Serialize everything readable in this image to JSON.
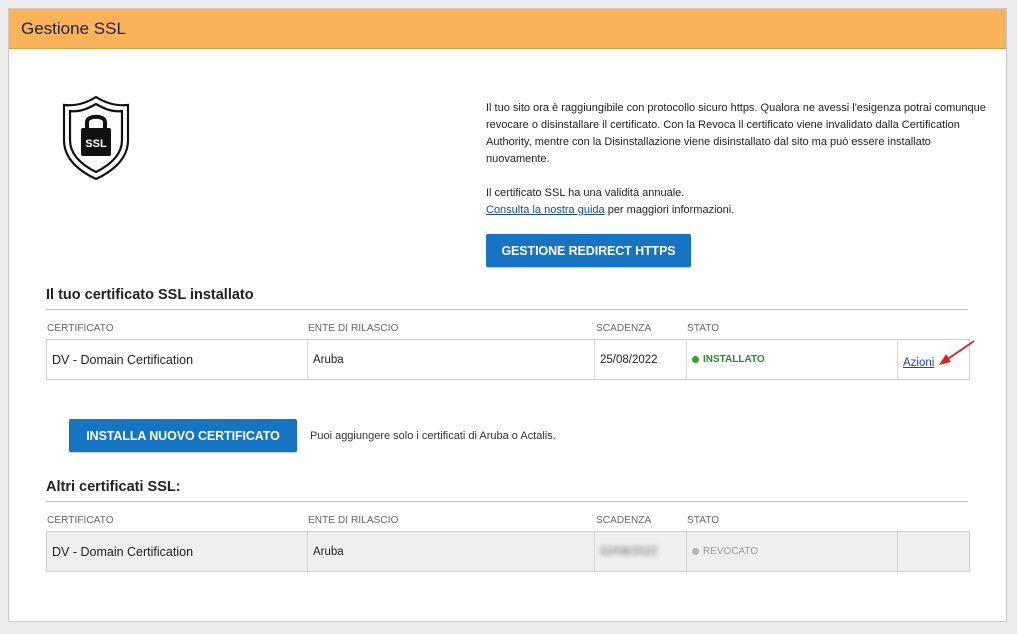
{
  "header": {
    "title": "Gestione SSL"
  },
  "logo": {
    "icon": "ssl-shield-lock-icon",
    "text": "SSL"
  },
  "intro": {
    "paragraph1": "Il tuo sito ora è raggiungibile con protocollo sicuro https. Qualora ne avessi l'esigenza potrai comunque revocare o disinstallare il certificato. Con la Revoca il certificato viene invalidato dalla Certification Authority, mentre con la Disinstallazione viene disinstallato dal sito ma può essere installato nuovamente.",
    "validity": "Il certificato SSL ha una validità annuale.",
    "guide_link": "Consulta la nostra guida",
    "guide_suffix": " per maggiori informazioni."
  },
  "buttons": {
    "redirect": "GESTIONE REDIRECT HTTPS",
    "install": "INSTALLA NUOVO CERTIFICATO"
  },
  "installed_section": {
    "title": "Il tuo certificato SSL installato",
    "columns": [
      "CERTIFICATO",
      "ENTE DI RILASCIO",
      "SCADENZA",
      "STATO"
    ],
    "row": {
      "certificate": "DV - Domain Certification",
      "issuer": "Aruba",
      "expiry": "25/08/2022",
      "status": "INSTALLATO",
      "action": "Azioni"
    }
  },
  "install_note": "Puoi aggiungere solo i certificati di Aruba o Actalis.",
  "other_section": {
    "title": "Altri certificati SSL:",
    "columns": [
      "CERTIFICATO",
      "ENTE DI RILASCIO",
      "SCADENZA",
      "STATO"
    ],
    "row": {
      "certificate": "DV - Domain Certification",
      "issuer": "Aruba",
      "expiry": "02/08/2022",
      "status": "REVOCATO"
    }
  },
  "colors": {
    "header_bg": "#fbb35a",
    "button_bg": "#1674c4",
    "status_installed": "#2e8b30",
    "status_revoked": "#9a9a9a",
    "link": "#1546b8",
    "arrow": "#e02020"
  }
}
